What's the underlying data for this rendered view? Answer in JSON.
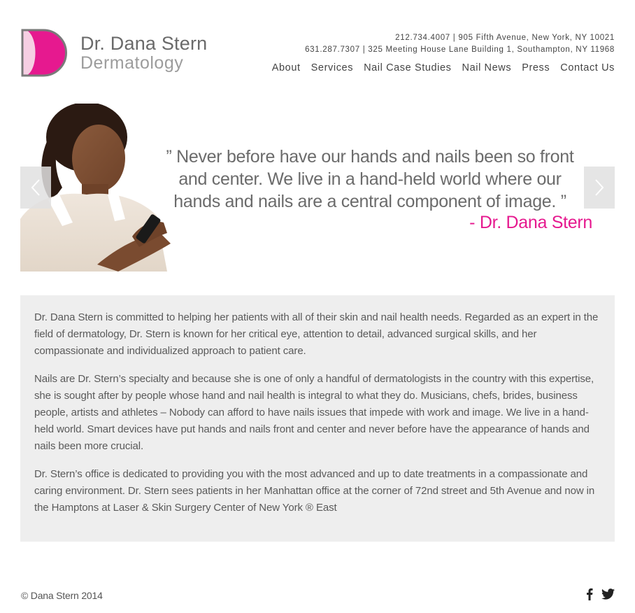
{
  "brand": {
    "name": "Dr. Dana Stern",
    "subtitle": "Dermatology",
    "accent_color": "#e6198f"
  },
  "contact": {
    "line1": "212.734.4007 | 905 Fifth Avenue, New York, NY 10021",
    "line2": "631.287.7307 | 325 Meeting House Lane Building 1, Southampton, NY 11968"
  },
  "nav": {
    "items": [
      {
        "label": "About"
      },
      {
        "label": "Services"
      },
      {
        "label": "Nail Case Studies"
      },
      {
        "label": "Nail News"
      },
      {
        "label": "Press"
      },
      {
        "label": "Contact Us"
      }
    ]
  },
  "hero": {
    "quote": "” Never before have our hands and nails been so front and center.  We live in a hand-held world where our hands and nails are a central component of image. ”",
    "author": "- Dr. Dana Stern",
    "prev_icon": "chevron-left-icon",
    "next_icon": "chevron-right-icon"
  },
  "content": {
    "paragraphs": [
      "Dr. Dana Stern is committed to helping her patients with all of their skin and nail health needs. Regarded as an expert in the field of dermatology, Dr. Stern is known for her critical eye, attention to detail, advanced surgical skills, and her compassionate and individualized approach to patient care.",
      "Nails are Dr. Stern’s specialty and because she is one of only a handful of dermatologists in the country with this expertise, she is sought after by people whose hand and nail health is integral to what they do. Musicians, chefs, brides, business people, artists and athletes – Nobody can afford to have nails issues that impede with work and image. We live in a hand-held world. Smart devices have put hands and nails front and center and never before have the appearance of hands and nails been more crucial.",
      "Dr. Stern’s office is dedicated to providing you with the most advanced and up to date treatments in a compassionate and caring environment. Dr. Stern sees patients in her Manhattan office at the corner of 72nd street and 5th Avenue and now in the Hamptons at Laser & Skin Surgery Center of New York ® East"
    ]
  },
  "footer": {
    "copyright": "© Dana Stern 2014",
    "social": [
      "facebook-icon",
      "twitter-icon"
    ]
  }
}
